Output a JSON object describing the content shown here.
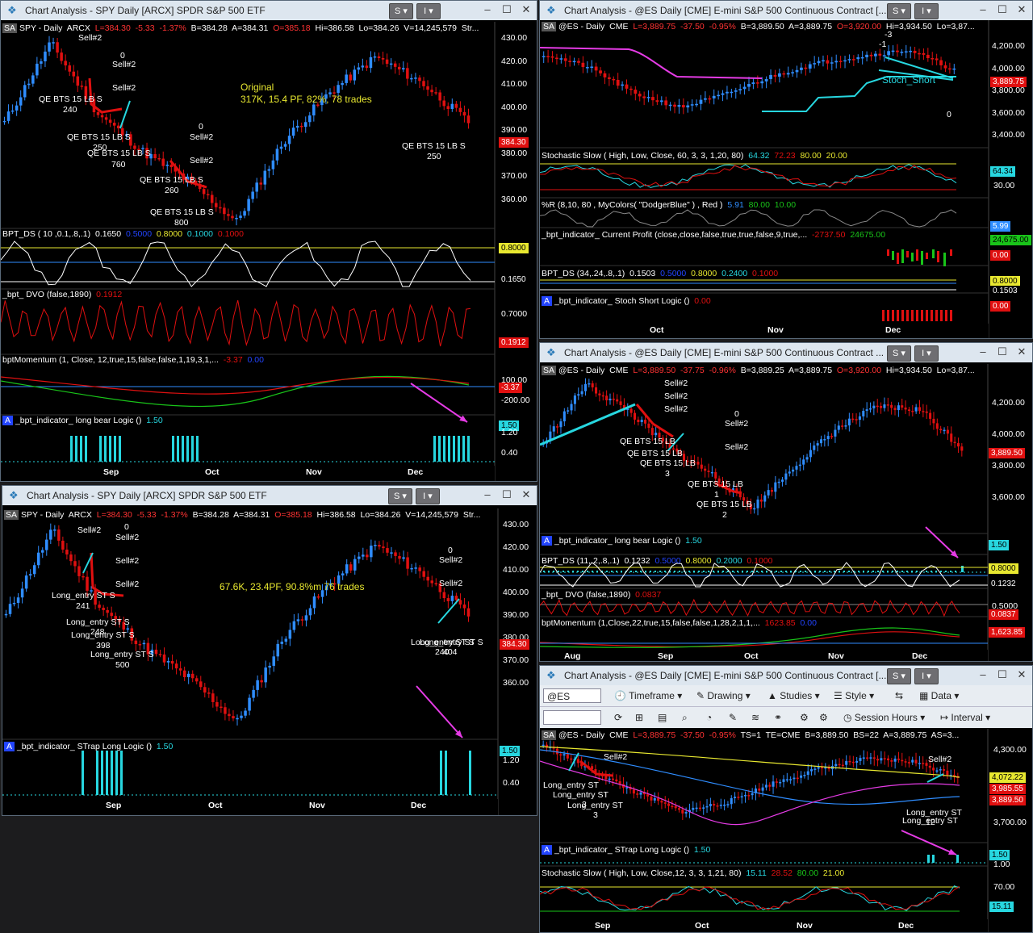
{
  "windows": {
    "w1": {
      "title": "Chart Analysis - SPY Daily [ARCX] SPDR S&P 500 ETF",
      "symbol_line": {
        "sa": "SA",
        "sym": "SPY - Daily",
        "exch": "ARCX",
        "last": "L=384.30",
        "chg": "-5.33",
        "pct": "-1.37%",
        "bid": "B=384.28",
        "ask": "A=384.31",
        "open": "O=385.18",
        "hi": "Hi=386.58",
        "lo": "Lo=384.26",
        "vol": "V=14,245,579",
        "more": "Str..."
      },
      "annotation": "Original",
      "annotation2": "317K, 15.4 PF, 82%, 78 trades",
      "price_axis": [
        "430.00",
        "420.00",
        "410.00",
        "400.00",
        "390.00",
        "380.00",
        "370.00",
        "360.00"
      ],
      "last_price_label": "384.30",
      "months": [
        "Sep",
        "Oct",
        "Nov",
        "Dec"
      ],
      "signals": [
        "Sell#2",
        "0",
        "Sell#2",
        "Sell#2",
        "0",
        "Sell#2",
        "Sell#2"
      ],
      "entries": [
        {
          "label": "QE BTS 15 LB S",
          "qty": "240"
        },
        {
          "label": "QE BTS 15 LB S",
          "qty": "250"
        },
        {
          "label": "QE BTS 15 LB S",
          "qty": "760"
        },
        {
          "label": "QE BTS 15 LB S",
          "qty": "260"
        },
        {
          "label": "QE BTS 15 LB S",
          "qty": "800"
        },
        {
          "label": "QE BTS 15 LB S",
          "qty": "250"
        }
      ],
      "bptds": {
        "name": "BPT_DS ( 10 ,0.1,.8,.1)",
        "v1": "0.1650",
        "v2": "0.5000",
        "v3": "0.8000",
        "v4": "0.1000",
        "v5": "0.1000",
        "ax1": "0.8000",
        "ax2": "0.1650"
      },
      "dvo": {
        "name": "_bpt_ DVO  (false,1890)",
        "v1": "0.1912",
        "ax1": "0.7000",
        "ax2": "0.1912"
      },
      "momentum": {
        "name": "bptMomentum (1, Close, 12,true,15,false,false,1,19,3,1,...",
        "v1": "-3.37",
        "v2": "0.00",
        "ax1": "100.00",
        "ax2": "-3.37",
        "ax3": "-200.00"
      },
      "logic": {
        "name": "_bpt_indicator_ long bear Logic ()",
        "v1": "1.50",
        "ax1": "1.50",
        "ax2": "1.20",
        "ax3": "0.40"
      }
    },
    "w2": {
      "title": "Chart Analysis - @ES Daily [CME] E-mini S&P 500 Continuous Contract [...",
      "symbol_line": {
        "sa": "SA",
        "sym": "@ES - Daily",
        "exch": "CME",
        "last": "L=3,889.75",
        "chg": "-37.50",
        "pct": "-0.95%",
        "bid": "B=3,889.50",
        "ask": "A=3,889.75",
        "open": "O=3,920.00",
        "hi": "Hi=3,934.50",
        "lo": "Lo=3,87..."
      },
      "price_axis": [
        "4,200.00",
        "4,000.00",
        "3,800.00",
        "3,600.00",
        "3,400.00"
      ],
      "last_price_label": "3,889.75",
      "months": [
        "Oct",
        "Nov",
        "Dec"
      ],
      "line_label": "Stoch_Short",
      "marks": [
        "-3",
        "-1",
        "0"
      ],
      "stoch": {
        "name": "Stochastic Slow ( High, Low, Close, 60, 3, 3, 1,20, 80)",
        "v1": "64.32",
        "v2": "72.23",
        "v3": "80.00",
        "v4": "20.00",
        "ax1": "64.34",
        "ax2": "30.00"
      },
      "pctr": {
        "name": "%R (8,10, 80 , MyColors( \"DodgerBlue\" ) , Red )",
        "v1": "5.91",
        "v2": "80.00",
        "v3": "10.00",
        "ax1": "5.99"
      },
      "profit": {
        "name": "_bpt_indicator_ Current Profit (close,close,false,true,true,false,9,true,...",
        "v1": "-2737.50",
        "v2": "24675.00",
        "ax1": "24,675.00",
        "ax2": "0.00"
      },
      "bptds": {
        "name": "BPT_DS (34,.24,.8,.1)",
        "v1": "0.1503",
        "v2": "0.5000",
        "v3": "0.8000",
        "v4": "0.2400",
        "v5": "0.1000",
        "ax1": "0.8000",
        "ax2": "0.1503"
      },
      "logic": {
        "name": "_bpt_indicator_ Stoch Short Logic ()",
        "v1": "0.00",
        "ax1": "0.00"
      }
    },
    "w3": {
      "title": "Chart Analysis - @ES Daily [CME] E-mini S&P 500 Continuous Contract ...",
      "symbol_line": {
        "sa": "SA",
        "sym": "@ES - Daily",
        "exch": "CME",
        "last": "L=3,889.50",
        "chg": "-37.75",
        "pct": "-0.96%",
        "bid": "B=3,889.25",
        "ask": "A=3,889.75",
        "open": "O=3,920.00",
        "hi": "Hi=3,934.50",
        "lo": "Lo=3,87..."
      },
      "price_axis": [
        "4,200.00",
        "4,000.00",
        "3,800.00",
        "3,600.00"
      ],
      "last_price_label": "3,889.50",
      "months": [
        "Aug",
        "Sep",
        "Oct",
        "Nov",
        "Dec"
      ],
      "signals": [
        "Sell#2",
        "Sell#2",
        "Sell#2",
        "0",
        "Sell#2",
        "Sell#2"
      ],
      "entries": [
        {
          "label": "QE BTS 15 LB",
          "qty": "2"
        },
        {
          "label": "QE BTS 15 LB",
          "qty": "3"
        },
        {
          "label": "QE BTS 15 LB",
          "qty": "1"
        },
        {
          "label": "QE BTS 15 LB",
          "qty": "2"
        }
      ],
      "logic": {
        "name": "_bpt_indicator_ long bear Logic ()",
        "v1": "1.50",
        "ax1": "1.50"
      },
      "bptds": {
        "name": "BPT_DS (11,.2,.8,.1)",
        "v1": "0.1232",
        "v2": "0.5000",
        "v3": "0.8000",
        "v4": "0.2000",
        "v5": "0.1000",
        "ax1": "0.8000",
        "ax2": "0.1232"
      },
      "dvo": {
        "name": "_bpt_ DVO  (false,1890)",
        "v1": "0.0837",
        "ax1": "0.5000",
        "ax2": "0.0837"
      },
      "momentum": {
        "name": "bptMomentum (1,Close,22,true,15,false,false,1,28,2,1,1,...",
        "v1": "1623.85",
        "v2": "0.00",
        "ax1": "1,623.85"
      }
    },
    "w4": {
      "title": "Chart Analysis - SPY Daily [ARCX] SPDR S&P 500 ETF",
      "symbol_line": {
        "sa": "SA",
        "sym": "SPY - Daily",
        "exch": "ARCX",
        "last": "L=384.30",
        "chg": "-5.33",
        "pct": "-1.37%",
        "bid": "B=384.28",
        "ask": "A=384.31",
        "open": "O=385.18",
        "hi": "Hi=386.58",
        "lo": "Lo=384.26",
        "vol": "V=14,245,579",
        "more": "Str..."
      },
      "annotation": "67.6K, 23.4PF, 90.8%m 76 trades",
      "price_axis": [
        "430.00",
        "420.00",
        "410.00",
        "400.00",
        "390.00",
        "380.00",
        "370.00",
        "360.00"
      ],
      "last_price_label": "384.30",
      "months": [
        "Sep",
        "Oct",
        "Nov",
        "Dec"
      ],
      "signals": [
        "Sell#2",
        "0",
        "Sell#2",
        "Sell#2",
        "Sell#2",
        "0",
        "Sell#2",
        "Sell#2"
      ],
      "entries": [
        {
          "label": "Long_entry ST S",
          "qty": "241"
        },
        {
          "label": "Long_entry ST S",
          "qty": "248"
        },
        {
          "label": "Long_entry ST S",
          "qty": "398"
        },
        {
          "label": "Long_entry ST S",
          "qty": "500"
        },
        {
          "label": "Long_entry ST S",
          "qty": "240"
        },
        {
          "label": "Long_entry ST S",
          "qty": "404"
        }
      ],
      "logic": {
        "name": "_bpt_indicator_ STrap Long Logic ()",
        "v1": "1.50",
        "ax1": "1.50",
        "ax2": "1.20",
        "ax3": "0.40"
      }
    },
    "w5": {
      "title": "Chart Analysis - @ES Daily [CME] E-mini S&P 500 Continuous Contract [...",
      "toolbar": {
        "symbol": "@ES",
        "timeframe": "Timeframe",
        "drawing": "Drawing",
        "studies": "Studies",
        "style": "Style",
        "data": "Data",
        "session_hours": "Session Hours",
        "interval": "Interval"
      },
      "symbol_line": {
        "sa": "SA",
        "sym": "@ES - Daily",
        "exch": "CME",
        "last": "L=3,889.75",
        "chg": "-37.50",
        "pct": "-0.95%",
        "ts": "TS=1",
        "te": "TE=CME",
        "bid": "B=3,889.50",
        "bs": "BS=22",
        "ask": "A=3,889.75",
        "as": "AS=3..."
      },
      "price_axis": [
        "4,300.00",
        "3,700.00"
      ],
      "price_tags": [
        "4,072.22",
        "3,985.55",
        "3,889.50"
      ],
      "months": [
        "Sep",
        "Oct",
        "Nov",
        "Dec"
      ],
      "signals": [
        "Sell#2",
        "Sell#2"
      ],
      "entries": [
        {
          "label": "Long_entry ST",
          "qty": "2"
        },
        {
          "label": "Long_entry ST",
          "qty": "3"
        },
        {
          "label": "Long_entry ST",
          "qty": "12"
        }
      ],
      "logic": {
        "name": "_bpt_indicator_ STrap Long Logic ()",
        "v1": "1.50",
        "ax1": "1.50",
        "ax2": "1.00"
      },
      "stoch": {
        "name": "Stochastic Slow ( High, Low, Close,12, 3, 3, 1,21, 80)",
        "v1": "15.11",
        "v2": "28.52",
        "v3": "80.00",
        "v4": "21.00",
        "ax1": "70.00",
        "ax2": "15.11"
      }
    }
  },
  "colors": {
    "up": "#2f8dff",
    "down": "#e01010",
    "green": "#19c419",
    "cyan": "#27d7e0",
    "magenta": "#e53be5",
    "yellow": "#e8e830",
    "white": "#ffffff",
    "axisbg": "#000000"
  },
  "icons": [
    "chart-app-icon",
    "dropdown-s-icon",
    "dropdown-i-icon",
    "minimize-icon",
    "maximize-icon",
    "close-icon"
  ]
}
